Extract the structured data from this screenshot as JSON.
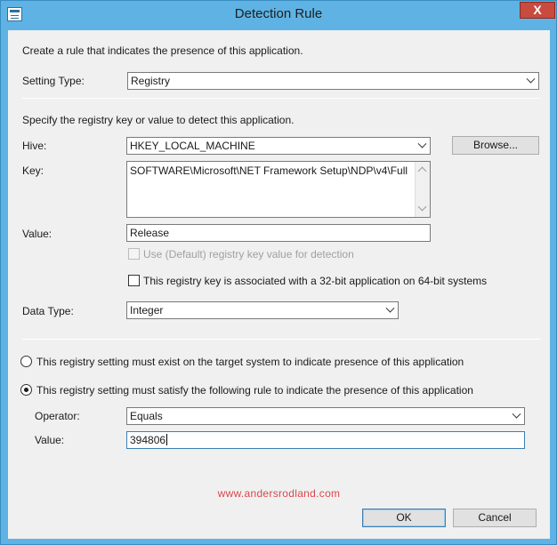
{
  "window": {
    "title": "Detection Rule",
    "close_glyph": "X",
    "icon": "window-icon"
  },
  "intro": "Create a rule that indicates the presence of this application.",
  "setting_type": {
    "label": "Setting Type:",
    "value": "Registry"
  },
  "registry_section": {
    "description": "Specify the registry key or value to detect this application.",
    "hive": {
      "label": "Hive:",
      "value": "HKEY_LOCAL_MACHINE"
    },
    "browse_label": "Browse...",
    "key": {
      "label": "Key:",
      "value": "SOFTWARE\\Microsoft\\NET Framework Setup\\NDP\\v4\\Full"
    },
    "value": {
      "label": "Value:",
      "value": "Release"
    },
    "use_default": {
      "label": "Use (Default) registry key value for detection",
      "checked": false,
      "enabled": false
    },
    "is_32bit": {
      "label": "This registry key is associated with a 32-bit application on 64-bit systems",
      "checked": false
    },
    "data_type": {
      "label": "Data Type:",
      "value": "Integer"
    }
  },
  "rule_options": {
    "must_exist": {
      "label": "This registry setting must exist on the target system to indicate presence of this application",
      "selected": false
    },
    "must_satisfy": {
      "label": "This registry setting must satisfy the following rule to indicate the presence of this application",
      "selected": true
    },
    "operator": {
      "label": "Operator:",
      "value": "Equals"
    },
    "value": {
      "label": "Value:",
      "value": "394806"
    }
  },
  "watermark": "www.andersrodland.com",
  "buttons": {
    "ok": "OK",
    "cancel": "Cancel"
  },
  "colors": {
    "titlebar": "#5eb3e4",
    "close": "#c74b3f",
    "watermark": "#d9484d",
    "client": "#f0f0f0"
  }
}
